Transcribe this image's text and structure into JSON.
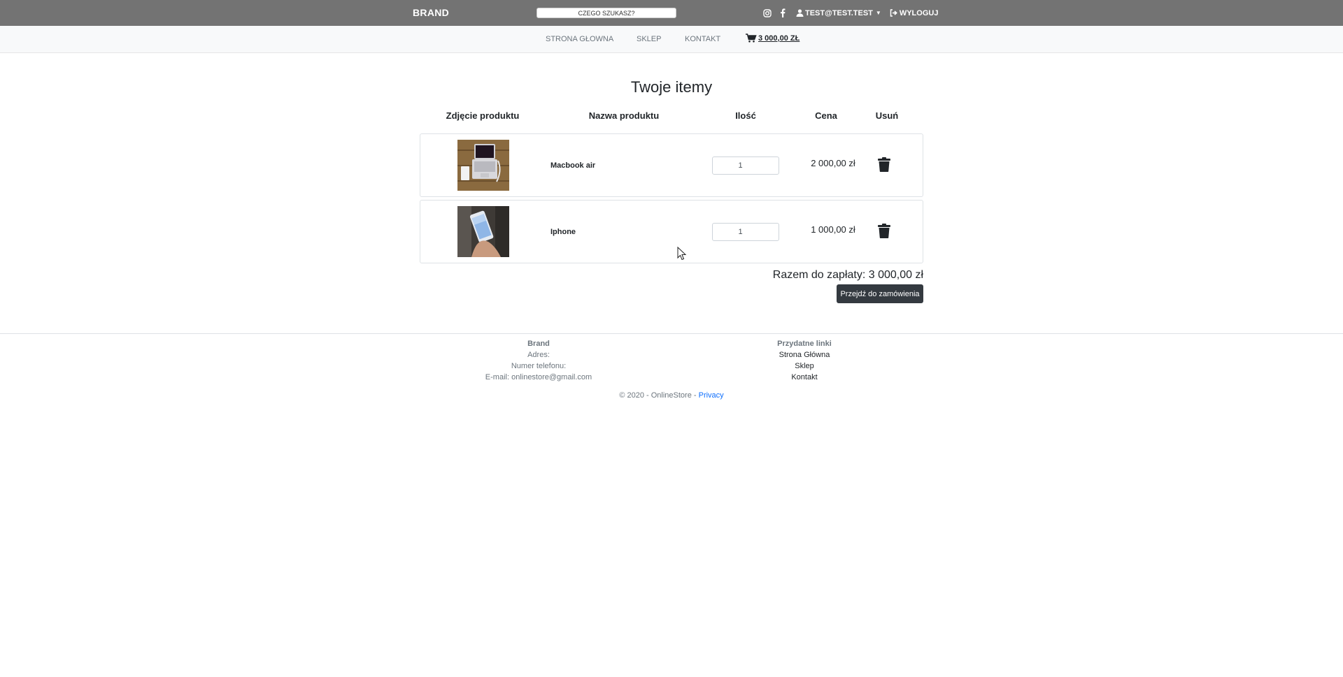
{
  "header": {
    "brand": "BRAND",
    "search_placeholder": "CZEGO SZUKASZ?",
    "user_label": "TEST@TEST.TEST",
    "logout_label": "WYLOGUJ",
    "icons": [
      "instagram-icon",
      "facebook-icon",
      "user-icon",
      "logout-icon"
    ],
    "bg_color": "#737373"
  },
  "nav": {
    "items": [
      {
        "label": "STRONA GŁOWNA"
      },
      {
        "label": "SKLEP"
      },
      {
        "label": "KONTAKT"
      }
    ],
    "cart_total": "3 000,00 ZŁ"
  },
  "cart": {
    "title": "Twoje itemy",
    "columns": [
      "Zdjęcie produktu",
      "Nazwa produktu",
      "Ilość",
      "Cena",
      "Usuń"
    ],
    "items": [
      {
        "name": "Macbook air",
        "quantity": "1",
        "price": "2 000,00 zł",
        "image": "laptop-photo"
      },
      {
        "name": "Iphone",
        "quantity": "1",
        "price": "1 000,00 zł",
        "image": "phone-photo"
      }
    ],
    "total_label": "Razem do zapłaty: 3 000,00 zł",
    "order_button": "Przejdź do zamówienia"
  },
  "footer": {
    "col1": {
      "heading": "Brand",
      "lines": [
        "Adres:",
        "Numer telefonu:",
        "E-mail: onlinestore@gmail.com"
      ]
    },
    "col2": {
      "heading": "Przydatne linki",
      "links": [
        "Strona Główna",
        "Sklep",
        "Kontakt"
      ]
    },
    "copyright": "© 2020 - OnlineStore - ",
    "privacy": "Privacy"
  }
}
